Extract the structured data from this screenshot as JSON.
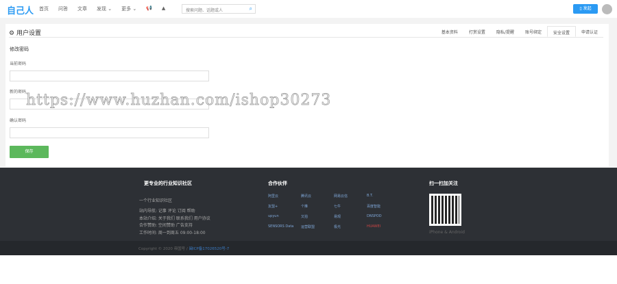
{
  "header": {
    "logo": "自己人",
    "nav": [
      "首页",
      "问答",
      "文章",
      "发现 ⌄",
      "更多 ⌄"
    ],
    "search_placeholder": "搜索问题、话题或人",
    "publish": "发起"
  },
  "page": {
    "title": "用户设置",
    "tabs": [
      "基本资料",
      "打赏设置",
      "隐私/提醒",
      "账号绑定",
      "安全设置",
      "申请认证"
    ],
    "active_tab": "安全设置",
    "section": "修改密码",
    "fields": [
      {
        "label": "当前密码",
        "value": ""
      },
      {
        "label": "新的密码",
        "value": ""
      },
      {
        "label": "确认密码",
        "value": ""
      }
    ],
    "save": "保存"
  },
  "watermark": "https://www.huzhan.com/ishop30273",
  "footer": {
    "col1_title": "更专业的行业知识社区",
    "slogan": "一个行业知识社区",
    "lines": [
      "站内导航: 记事 评论 订阅 帮助",
      "本站介绍: 关于我们 联系我们 用户协议",
      "合作赞助: 空间赞助 广告支持",
      "工作时间: 周一到周五 09:00-18:00"
    ],
    "col2_title": "合作伙伴",
    "partners": [
      "阿里云",
      "腾讯云",
      "网易云信",
      "B.T.",
      "友盟+",
      "个推",
      "七牛",
      "百度智能",
      "upyun",
      "又拍",
      "易观",
      "DNSPOD",
      "SENSORS Data",
      "运营联盟",
      "极光",
      "HUAWEI"
    ],
    "col3_title": "扫一扫加关注",
    "qr_caption": "iPhone & Android",
    "copyright": "Copyright © 2020 帝国号 / ",
    "icp": "闽ICP备17026520号-7"
  }
}
